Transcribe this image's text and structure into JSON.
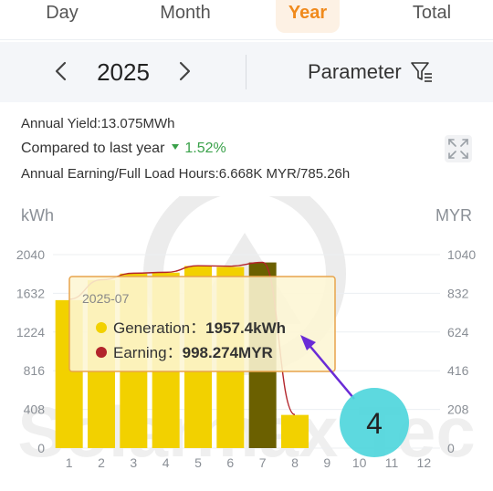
{
  "tabs": [
    {
      "label": "Day",
      "active": false
    },
    {
      "label": "Month",
      "active": false
    },
    {
      "label": "Year",
      "active": true
    },
    {
      "label": "Total",
      "active": false
    }
  ],
  "datebar": {
    "year": "2025",
    "parameter_label": "Parameter",
    "icons": {
      "prev": "chevron-left-icon",
      "next": "chevron-right-icon",
      "filter": "filter-icon"
    }
  },
  "summary": {
    "annual_yield": "Annual Yield:13.075MWh",
    "compared_label": "Compared to last year",
    "compared_value": "1.52%",
    "annual_earning": "Annual Earning/Full Load Hours:6.668K MYR/785.26h"
  },
  "colors": {
    "accent": "#f08a1c",
    "generation": "#f2d100",
    "generation_selected": "#6b6000",
    "earning_line": "#b3252b",
    "increase": "#3aa14a",
    "annotation": "#4fd6dc",
    "arrow": "#6a2bd6"
  },
  "watermark": "Solarmax Tec",
  "annotation": {
    "number": "4"
  },
  "tooltip": {
    "date": "2025-07",
    "generation_label": "Generation：",
    "generation_value": "1957.4kWh",
    "earning_label": "Earning：",
    "earning_value": "998.274MYR"
  },
  "chart_data": {
    "type": "bar",
    "ylabel_left": "kWh",
    "ylabel_right": "MYR",
    "categories": [
      "1",
      "2",
      "3",
      "4",
      "5",
      "6",
      "7",
      "8",
      "9",
      "10",
      "11",
      "12"
    ],
    "y_ticks_left": [
      "0",
      "408",
      "816",
      "1224",
      "1632",
      "2040"
    ],
    "y_ticks_right": [
      "0",
      "208",
      "416",
      "624",
      "832",
      "1040"
    ],
    "ylim_left": [
      0,
      2040
    ],
    "ylim_right": [
      0,
      1040
    ],
    "selected_index": 6,
    "series": [
      {
        "name": "Generation",
        "type": "bar",
        "axis": "left",
        "values": [
          1560,
          1770,
          1840,
          1850,
          1920,
          1910,
          1957.4,
          350,
          0,
          0,
          0,
          0
        ]
      },
      {
        "name": "Earning",
        "type": "line",
        "axis": "right",
        "values": [
          800,
          905,
          940,
          945,
          980,
          978,
          998.274,
          180,
          null,
          null,
          null,
          null
        ]
      }
    ]
  }
}
